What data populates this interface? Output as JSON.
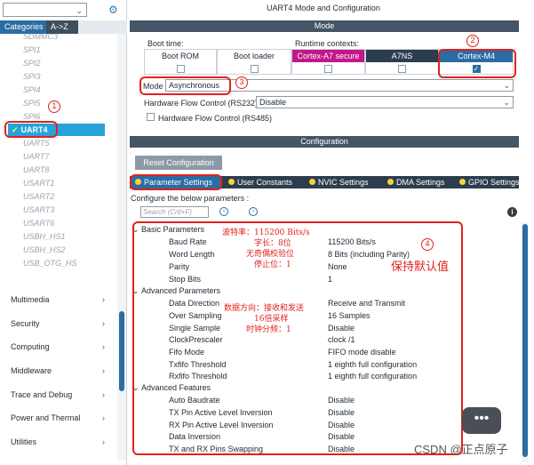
{
  "left": {
    "tabs": [
      "Categories",
      "A->Z"
    ],
    "peripherals": [
      "SDMMC3",
      "SPI1",
      "SPI2",
      "SPI3",
      "SPI4",
      "SPI5",
      "SPI6",
      "UART4",
      "UART5",
      "UART7",
      "UART8",
      "USART1",
      "USART2",
      "USART3",
      "USART6",
      "USBH_HS1",
      "USBH_HS2",
      "USB_OTG_HS"
    ],
    "selected_index": 7,
    "categories": [
      "Multimedia",
      "Security",
      "Computing",
      "Middleware",
      "Trace and Debug",
      "Power and Thermal",
      "Utilities"
    ]
  },
  "header": {
    "title": "UART4 Mode and Configuration"
  },
  "mode": {
    "section": "Mode",
    "boot_label": "Boot time:",
    "runtime_label": "Runtime contexts:",
    "contexts": [
      {
        "name": "Boot ROM",
        "checked": false
      },
      {
        "name": "Boot loader",
        "checked": false
      },
      {
        "name": "Cortex-A7 secure",
        "checked": false
      },
      {
        "name": "A7NS",
        "checked": false
      },
      {
        "name": "Cortex-M4",
        "checked": true
      }
    ],
    "mode_label": "Mode",
    "mode_value": "Asynchronous",
    "hfc232_label": "Hardware Flow Control (RS232)",
    "hfc232_value": "Disable",
    "hfc485_label": "Hardware Flow Control (RS485)"
  },
  "config": {
    "section": "Configuration",
    "reset_label": "Reset Configuration",
    "tabs": [
      "Parameter Settings",
      "User Constants",
      "NVIC Settings",
      "DMA Settings",
      "GPIO Settings"
    ],
    "configure_text": "Configure the below parameters :",
    "search_placeholder": "Search (Crtl+F)",
    "groups": [
      {
        "name": "Basic Parameters",
        "params": [
          {
            "name": "Baud Rate",
            "value": "115200 Bits/s"
          },
          {
            "name": "Word Length",
            "value": "8 Bits (including Parity)"
          },
          {
            "name": "Parity",
            "value": "None"
          },
          {
            "name": "Stop Bits",
            "value": "1"
          }
        ]
      },
      {
        "name": "Advanced Parameters",
        "params": [
          {
            "name": "Data Direction",
            "value": "Receive and Transmit"
          },
          {
            "name": "Over Sampling",
            "value": "16 Samples"
          },
          {
            "name": "Single Sample",
            "value": "Disable"
          },
          {
            "name": "ClockPrescaler",
            "value": "clock /1"
          },
          {
            "name": "Fifo Mode",
            "value": "FIFO mode disable"
          },
          {
            "name": "Txfifo Threshold",
            "value": "1 eighth full configuration"
          },
          {
            "name": "Rxfifo Threshold",
            "value": "1 eighth full configuration"
          }
        ]
      },
      {
        "name": "Advanced Features",
        "params": [
          {
            "name": "Auto Baudrate",
            "value": "Disable"
          },
          {
            "name": "TX Pin Active Level Inversion",
            "value": "Disable"
          },
          {
            "name": "RX Pin Active Level Inversion",
            "value": "Disable"
          },
          {
            "name": "Data Inversion",
            "value": "Disable"
          },
          {
            "name": "TX and RX Pins Swapping",
            "value": "Disable"
          }
        ]
      }
    ]
  },
  "annotations": {
    "numbers": [
      "1",
      "2",
      "3",
      "4"
    ],
    "notes1": [
      "波特率：115200 Bits/s",
      "字长：8位",
      "无奇偶校验位",
      "停止位：1"
    ],
    "notes2": [
      "数据方向：接收和发送",
      "16倍采样",
      "时钟分频：1"
    ],
    "keep_default": "保持默认值"
  },
  "watermark": "CSDN @正点原子"
}
